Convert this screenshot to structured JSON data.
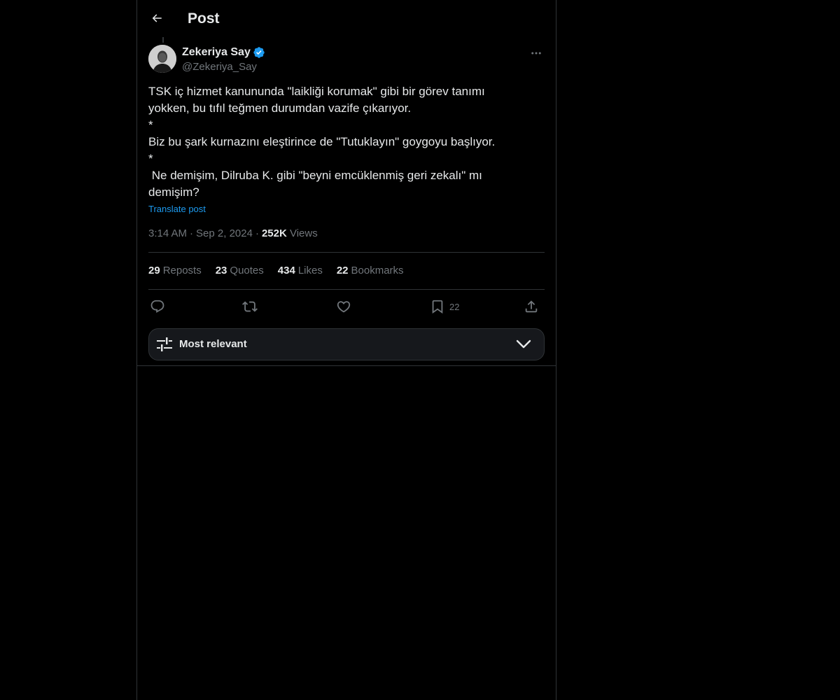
{
  "header": {
    "title": "Post",
    "back_icon": "arrow-left-icon"
  },
  "author": {
    "name": "Zekeriya Say",
    "handle": "@Zekeriya_Say",
    "verified": true,
    "verified_color": "#1d9bf0"
  },
  "post": {
    "text": "TSK iç hizmet kanununda \"laikliği korumak\" gibi bir görev tanımı\nyokken, bu tıfıl teğmen durumdan vazife çıkarıyor.\n*\nBiz bu şark kurnazını eleştirince de \"Tutuklayın\" goygoyu başlıyor.\n*\n Ne demişim, Dilruba K. gibi \"beyni emcüklenmiş geri zekalı\" mı\ndemişim?",
    "translate_label": "Translate post",
    "time": "3:14 AM",
    "date": "Sep 2, 2024",
    "views_count": "252K",
    "views_label": "Views"
  },
  "stats": {
    "reposts_count": "29",
    "reposts_label": "Reposts",
    "quotes_count": "23",
    "quotes_label": "Quotes",
    "likes_count": "434",
    "likes_label": "Likes",
    "bookmarks_count": "22",
    "bookmarks_label": "Bookmarks"
  },
  "actions": {
    "reply_icon": "reply-icon",
    "repost_icon": "repost-icon",
    "like_icon": "heart-icon",
    "bookmark_icon": "bookmark-icon",
    "bookmark_count": "22",
    "share_icon": "share-icon"
  },
  "sort": {
    "label": "Most relevant",
    "icon": "sliders-icon",
    "chevron": "chevron-down-icon"
  },
  "colors": {
    "background": "#000000",
    "text": "#e7e9ea",
    "muted": "#71767b",
    "accent": "#1d9bf0",
    "border": "#2f3336"
  }
}
